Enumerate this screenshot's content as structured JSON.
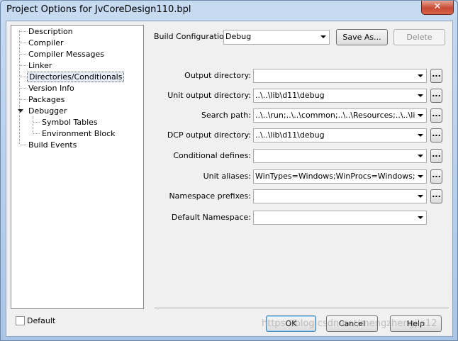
{
  "window": {
    "title": "Project Options for JvCoreDesign110.bpl",
    "close_label": "✕"
  },
  "tree": {
    "items": [
      {
        "label": "Description"
      },
      {
        "label": "Compiler"
      },
      {
        "label": "Compiler Messages"
      },
      {
        "label": "Linker"
      },
      {
        "label": "Directories/Conditionals",
        "selected": true
      },
      {
        "label": "Version Info"
      },
      {
        "label": "Packages"
      },
      {
        "label": "Debugger",
        "expanded": true
      },
      {
        "label": "Symbol Tables"
      },
      {
        "label": "Environment Block"
      },
      {
        "label": "Build Events"
      }
    ]
  },
  "build_config": {
    "label": "Build Configuration",
    "value": "Debug",
    "save_as_label": "Save As...",
    "delete_label": "Delete"
  },
  "fields": {
    "output_directory": {
      "label": "Output directory:",
      "value": ""
    },
    "unit_output_directory": {
      "label": "Unit output directory:",
      "value": "..\\..\\lib\\d11\\debug"
    },
    "search_path": {
      "label": "Search path:",
      "value": "..\\..\\run;..\\..\\common;..\\..\\Resources;..\\..\\lib"
    },
    "dcp_output_directory": {
      "label": "DCP output directory:",
      "value": "..\\..\\lib\\d11\\debug"
    },
    "conditional_defines": {
      "label": "Conditional defines:",
      "value": ""
    },
    "unit_aliases": {
      "label": "Unit aliases:",
      "value": "WinTypes=Windows;WinProcs=Windows;DbiT"
    },
    "namespace_prefixes": {
      "label": "Namespace prefixes:",
      "value": ""
    },
    "default_namespace": {
      "label": "Default Namespace:",
      "value": ""
    }
  },
  "browse_label": "...",
  "default_checkbox": {
    "label": "Default",
    "checked": false
  },
  "buttons": {
    "ok": "OK",
    "cancel": "Cancel",
    "help": "Help"
  },
  "watermark": "https://blog.csdn.net/mengzhengjie12"
}
